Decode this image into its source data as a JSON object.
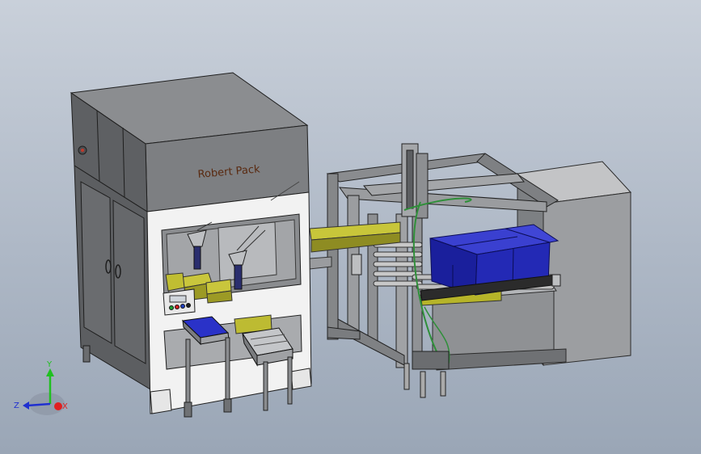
{
  "model": {
    "brand_label": "Robert Pack"
  },
  "triad": {
    "x_label": "X",
    "y_label": "Y",
    "z_label": "Z",
    "x_color": "#e02020",
    "y_color": "#20c020",
    "z_color": "#2030d0"
  },
  "colors": {
    "background_top": "#c9d0da",
    "background_bottom": "#9aa6b6",
    "frame_gray": "#7a7c7f",
    "cabinet_dark": "#5e6063",
    "panel_white": "#f2f2f2",
    "conveyor_olive": "#b6b429",
    "bag_blue": "#1a1f9c",
    "hose_green": "#2f8f3a"
  },
  "icons": [
    "cabinet-lock-icon",
    "control-panel-buttons",
    "coordinate-triad-icon"
  ]
}
